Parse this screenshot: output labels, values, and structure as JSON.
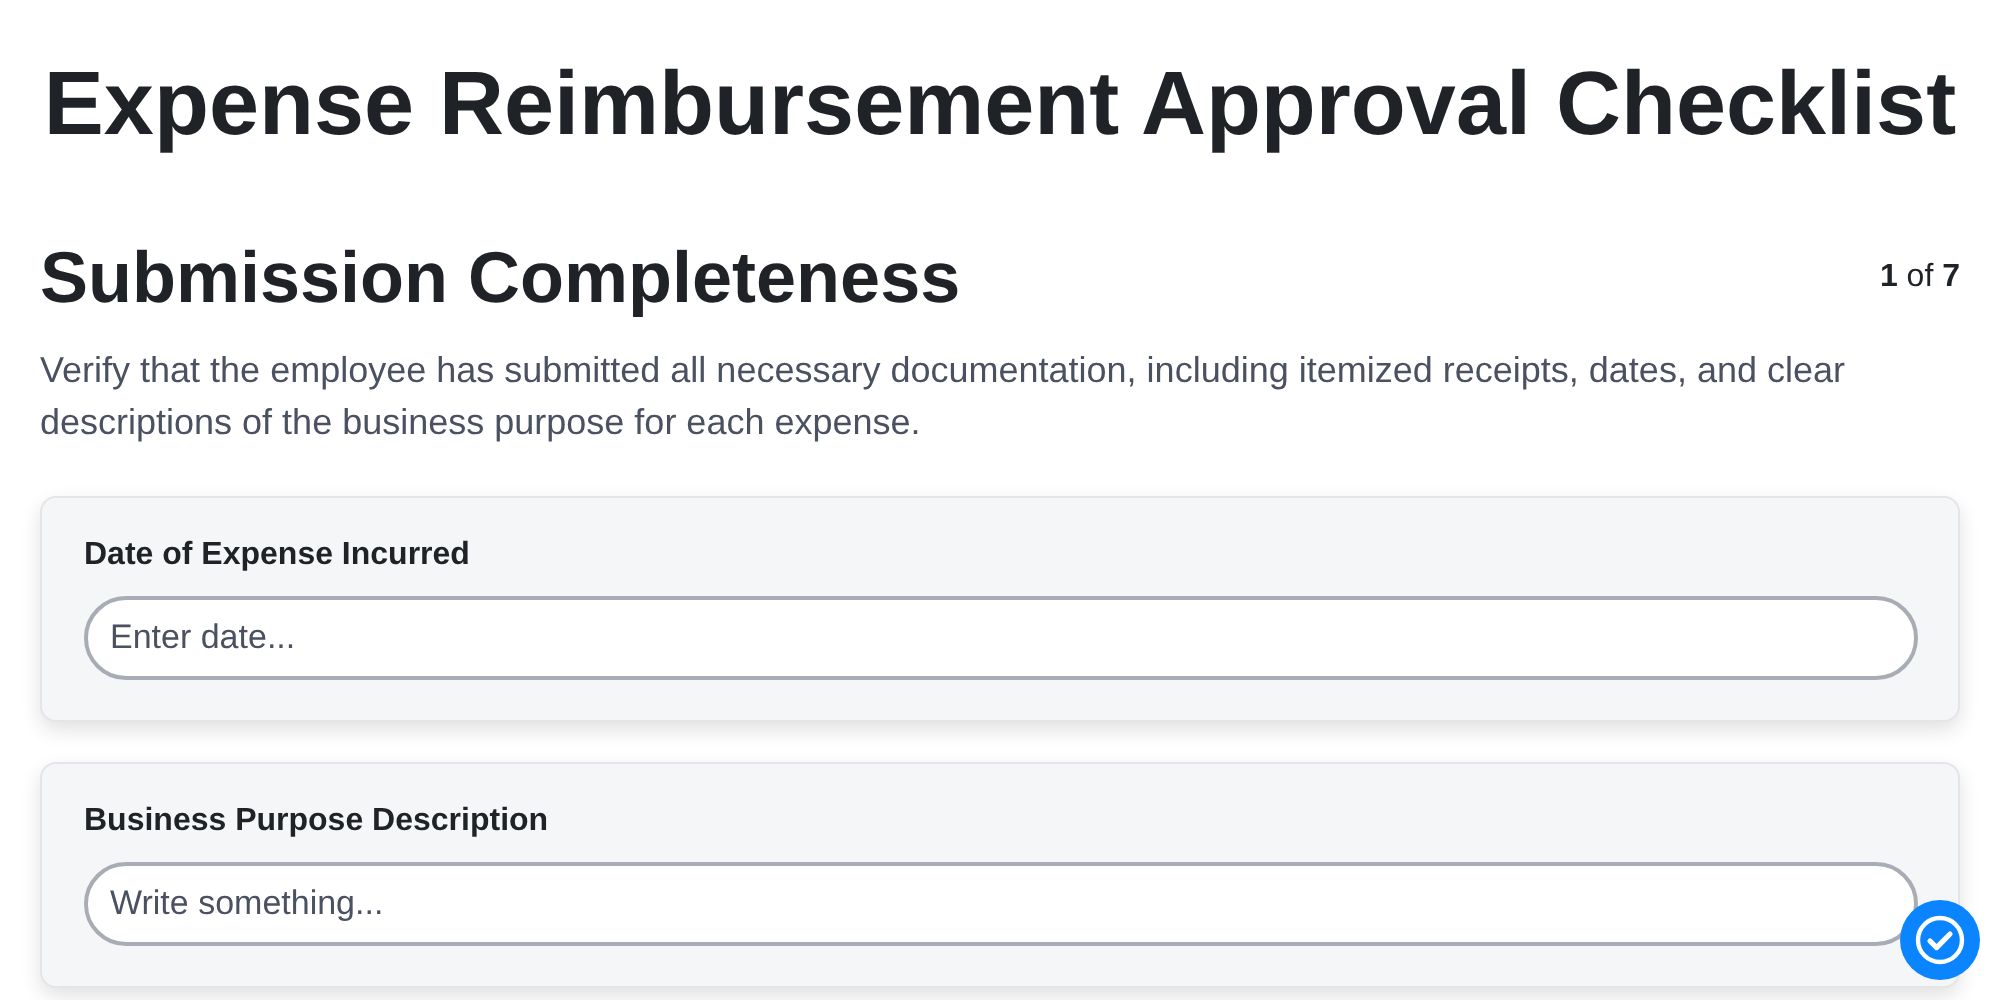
{
  "title": "Expense Reimbursement Approval Checklist",
  "section": {
    "heading": "Submission Completeness",
    "progress": "**1** of **7**",
    "description": "Verify that the employee has submitted all necessary documentation, including itemized receipts, dates, and clear descriptions of the business purpose for each expense."
  },
  "fields": [
    {
      "label": "Date of Expense Incurred",
      "placeholder": "Enter date..."
    },
    {
      "label": "Business Purpose Description",
      "placeholder": "Write something..."
    }
  ]
}
